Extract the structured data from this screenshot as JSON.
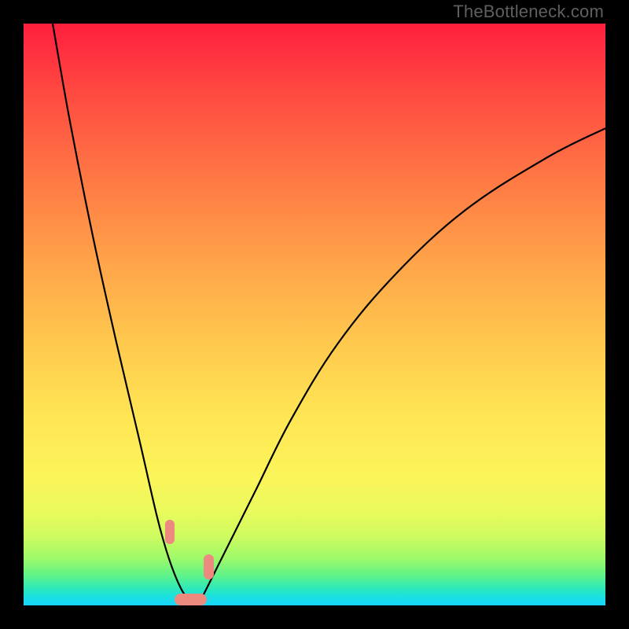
{
  "watermark": "TheBottleneck.com",
  "chart_data": {
    "type": "line",
    "title": "",
    "xlabel": "",
    "ylabel": "",
    "xlim": [
      0,
      100
    ],
    "ylim": [
      0,
      100
    ],
    "grid": false,
    "legend": false,
    "series": [
      {
        "name": "left-curve",
        "x": [
          5,
          8,
          12,
          16,
          20,
          23,
          25,
          27,
          28.5,
          30
        ],
        "values": [
          100,
          83,
          63,
          45,
          28,
          15,
          8,
          3,
          1,
          0
        ]
      },
      {
        "name": "right-curve",
        "x": [
          30,
          31,
          33,
          36,
          40,
          46,
          54,
          64,
          76,
          90,
          100
        ],
        "values": [
          0,
          2,
          6,
          12,
          20,
          32,
          45,
          57,
          68,
          77,
          82
        ]
      }
    ],
    "annotations": [
      {
        "name": "marker-top-left",
        "x": 24.3,
        "y": 10.5,
        "w": 1.7,
        "h": 4.3
      },
      {
        "name": "marker-top-right",
        "x": 31.0,
        "y": 4.5,
        "w": 1.7,
        "h": 4.3
      },
      {
        "name": "marker-bottom",
        "x": 26.0,
        "y": 0.0,
        "w": 5.5,
        "h": 2.0
      }
    ],
    "background_gradient": {
      "type": "vertical",
      "stops": [
        {
          "pos": 0.0,
          "color": "#ff1f3e"
        },
        {
          "pos": 0.25,
          "color": "#ff7344"
        },
        {
          "pos": 0.55,
          "color": "#ffc94e"
        },
        {
          "pos": 0.78,
          "color": "#fbf55a"
        },
        {
          "pos": 0.92,
          "color": "#9df96a"
        },
        {
          "pos": 1.0,
          "color": "#18d6ff"
        }
      ]
    }
  }
}
